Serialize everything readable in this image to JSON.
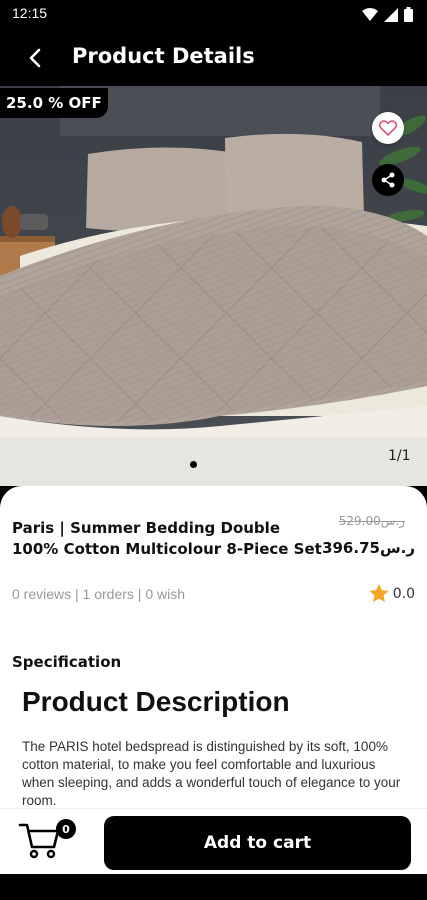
{
  "status_bar": {
    "time": "12:15",
    "icons": [
      "wifi-icon",
      "signal-icon",
      "battery-icon"
    ]
  },
  "app_bar": {
    "title": "Product Details",
    "back_icon": "back-arrow-icon"
  },
  "gallery": {
    "discount": "25.0 % OFF",
    "page_counter": "1/1",
    "favorite_icon": "heart-icon",
    "share_icon": "share-icon"
  },
  "product": {
    "name": "Paris | Summer Bedding Double 100% Cotton Multicolour 8-Piece Set",
    "old_price": "529.00ر.س",
    "new_price": "396.75ر.س",
    "stats": "0 reviews | 1 orders | 0 wish",
    "rating": "0.0",
    "rating_icon": "star-icon"
  },
  "specification": {
    "heading": "Specification",
    "description_heading": "Product Description",
    "description_text": "The PARIS hotel bedspread is distinguished by its soft, 100% cotton material, to make you feel comfortable and luxurious when sleeping, and adds a wonderful touch of elegance to your room."
  },
  "bottom_bar": {
    "cart_count": "0",
    "cart_icon": "cart-icon",
    "add_to_cart_label": "Add to cart"
  },
  "colors": {
    "primary": "#000000",
    "star": "#f5a623",
    "background": "#ffffff"
  }
}
